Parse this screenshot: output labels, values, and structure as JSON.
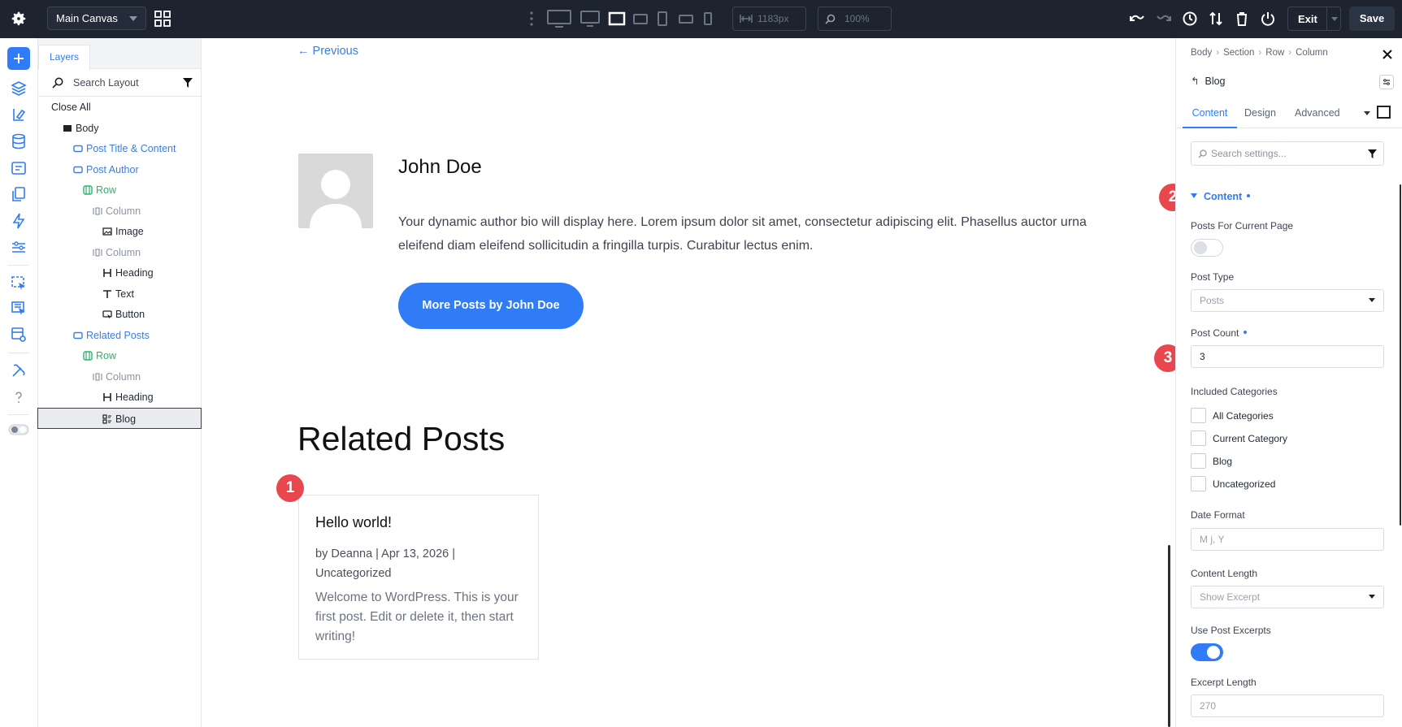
{
  "topbar": {
    "canvas_select": "Main Canvas",
    "width_value": "1183px",
    "zoom_value": "100%",
    "exit_label": "Exit",
    "save_label": "Save",
    "colors": {
      "bg": "#1d2430",
      "save_bg": "#2b3443"
    }
  },
  "layers_panel": {
    "tab_label": "Layers",
    "search_placeholder": "Search Layout",
    "close_all": "Close All",
    "items": [
      {
        "label": "Body",
        "icon": "section-block-icon",
        "color": "dark"
      },
      {
        "label": "Post Title & Content",
        "icon": "section-icon",
        "color": "blue"
      },
      {
        "label": "Post Author",
        "icon": "section-icon",
        "color": "blue"
      },
      {
        "label": "Row",
        "icon": "row-icon",
        "color": "green"
      },
      {
        "label": "Column",
        "icon": "column-icon",
        "color": "gray"
      },
      {
        "label": "Image",
        "icon": "image-icon",
        "color": "dark"
      },
      {
        "label": "Column",
        "icon": "column-icon",
        "color": "gray"
      },
      {
        "label": "Heading",
        "icon": "heading-icon",
        "color": "dark"
      },
      {
        "label": "Text",
        "icon": "text-icon",
        "color": "dark"
      },
      {
        "label": "Button",
        "icon": "button-icon",
        "color": "dark"
      },
      {
        "label": "Related Posts",
        "icon": "section-icon",
        "color": "blue"
      },
      {
        "label": "Row",
        "icon": "row-icon",
        "color": "green"
      },
      {
        "label": "Column",
        "icon": "column-icon",
        "color": "gray"
      },
      {
        "label": "Heading",
        "icon": "heading-icon",
        "color": "dark"
      },
      {
        "label": "Blog",
        "icon": "blog-icon",
        "color": "dark",
        "selected": true
      }
    ]
  },
  "canvas": {
    "previous_link": "← Previous",
    "author": {
      "name": "John Doe",
      "bio": "Your dynamic author bio will display here. Lorem ipsum dolor sit amet, consectetur adipiscing elit. Phasellus auctor urna eleifend diam eleifend sollicitudin a fringilla turpis. Curabitur lectus enim.",
      "button_label": "More Posts by John Doe"
    },
    "related_title": "Related Posts",
    "post": {
      "title": "Hello world!",
      "meta": "by Deanna | Apr 13, 2026 | Uncategorized",
      "excerpt": "Welcome to WordPress. This is your first post. Edit or delete it, then start writing!"
    },
    "badges": [
      "1",
      "2",
      "3"
    ],
    "accent_color": "#2f7cf6",
    "badge_color": "#e7474d"
  },
  "settings_panel": {
    "breadcrumb": [
      "Body",
      "Section",
      "Row",
      "Column"
    ],
    "module_title": "Blog",
    "tabs": [
      "Content",
      "Design",
      "Advanced"
    ],
    "active_tab": "Content",
    "search_placeholder": "Search settings...",
    "section_title": "Content",
    "fields": {
      "posts_for_current_page": {
        "label": "Posts For Current Page",
        "on": false
      },
      "post_type": {
        "label": "Post Type",
        "value": "Posts"
      },
      "post_count": {
        "label": "Post Count",
        "value": "3"
      },
      "included_categories": {
        "label": "Included Categories",
        "options": [
          "All Categories",
          "Current Category",
          "Blog",
          "Uncategorized"
        ]
      },
      "date_format": {
        "label": "Date Format",
        "placeholder": "M j, Y"
      },
      "content_length": {
        "label": "Content Length",
        "value": "Show Excerpt"
      },
      "use_post_excerpts": {
        "label": "Use Post Excerpts",
        "on": true
      },
      "excerpt_length": {
        "label": "Excerpt Length",
        "placeholder": "270"
      }
    }
  }
}
